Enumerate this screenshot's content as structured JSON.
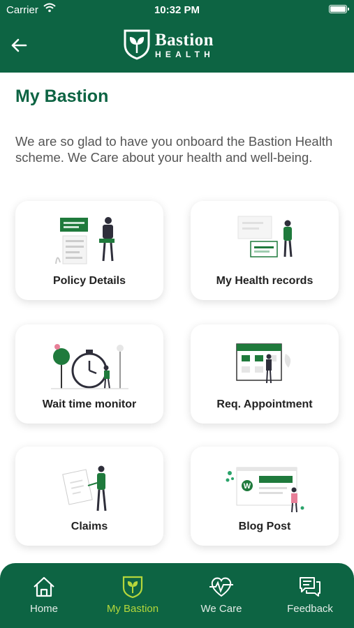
{
  "status_bar": {
    "carrier": "Carrier",
    "time": "10:32 PM"
  },
  "header": {
    "brand_name": "Bastion",
    "brand_sub": "HEALTH"
  },
  "page": {
    "title": "My Bastion",
    "intro": "We are so glad to have you onboard the Bastion Health scheme. We Care about your health and well-being."
  },
  "cards": [
    {
      "label": "Policy Details",
      "icon": "policy-illustration"
    },
    {
      "label": "My Health records",
      "icon": "health-records-illustration"
    },
    {
      "label": "Wait time monitor",
      "icon": "wait-time-illustration"
    },
    {
      "label": "Req. Appointment",
      "icon": "appointment-calendar-illustration"
    },
    {
      "label": "Claims",
      "icon": "claims-illustration"
    },
    {
      "label": "Blog Post",
      "icon": "blog-illustration"
    }
  ],
  "bottom_nav": [
    {
      "label": "Home",
      "icon": "home-icon"
    },
    {
      "label": "My Bastion",
      "icon": "bastion-shield-icon",
      "active": true
    },
    {
      "label": "We Care",
      "icon": "heart-pulse-icon"
    },
    {
      "label": "Feedback",
      "icon": "chat-icon"
    }
  ],
  "colors": {
    "brand_green": "#0d6443",
    "active_nav": "#b5d73b",
    "text_gray": "#555555",
    "accent_green": "#1f7a3c"
  }
}
